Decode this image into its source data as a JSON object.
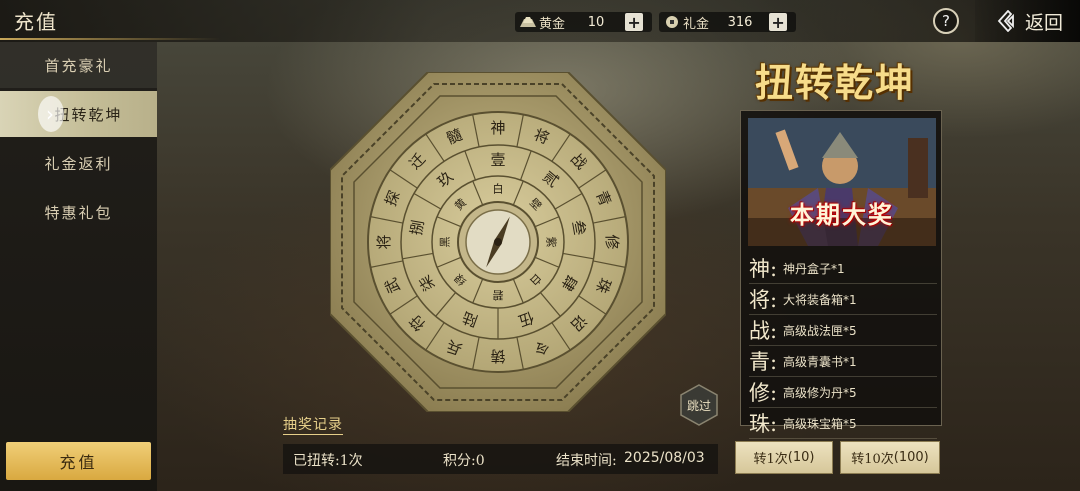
{
  "header": {
    "title": "充值",
    "gold_label": "黄金",
    "gold_value": "10",
    "gift_label": "礼金",
    "gift_value": "316",
    "help_label": "?",
    "back_label": "返回"
  },
  "sidebar": {
    "items": [
      {
        "label": "首充豪礼"
      },
      {
        "label": "扭转乾坤"
      },
      {
        "label": "礼金返利"
      },
      {
        "label": "特惠礼包"
      }
    ],
    "active_index": 1,
    "recharge_label": "充值"
  },
  "compass": {
    "inner_ring": [
      "白",
      "壁",
      "紫",
      "白",
      "碧",
      "绿",
      "黑",
      "黄"
    ],
    "middle_ring": [
      "壹",
      "贰",
      "叁",
      "肆",
      "伍",
      "陆",
      "柒",
      "捌",
      "玖"
    ],
    "outer_ring": [
      "神",
      "将",
      "战",
      "青",
      "修",
      "珠",
      "诏",
      "令",
      "铸",
      "兵",
      "符",
      "武",
      "将",
      "探",
      "迁",
      "髓"
    ]
  },
  "event": {
    "title": "扭转乾坤",
    "grand_prize_banner": "本期大奖",
    "prizes": [
      {
        "char": "神:",
        "text": "神丹盒子*1"
      },
      {
        "char": "将:",
        "text": "大将装备箱*1"
      },
      {
        "char": "战:",
        "text": "高级战法匣*5"
      },
      {
        "char": "青:",
        "text": "高级青囊书*1"
      },
      {
        "char": "修:",
        "text": "高级修为丹*5"
      },
      {
        "char": "珠:",
        "text": "高级珠宝箱*5"
      }
    ]
  },
  "skip_label": "跳过",
  "records_link": "抽奖记录",
  "stats": {
    "spun": "已扭转:1次",
    "points": "积分:0",
    "end_time_label": "结束时间:",
    "end_time": "2025/08/03"
  },
  "buttons": {
    "spin1": "转1次",
    "spin1_rate": "(10)",
    "spin10": "转10次",
    "spin10_rate": "(100)"
  },
  "colors": {
    "accent_gold": "#d9a940",
    "title_gold": "#f7dc8a",
    "compass_brass": "#a89a6a"
  }
}
